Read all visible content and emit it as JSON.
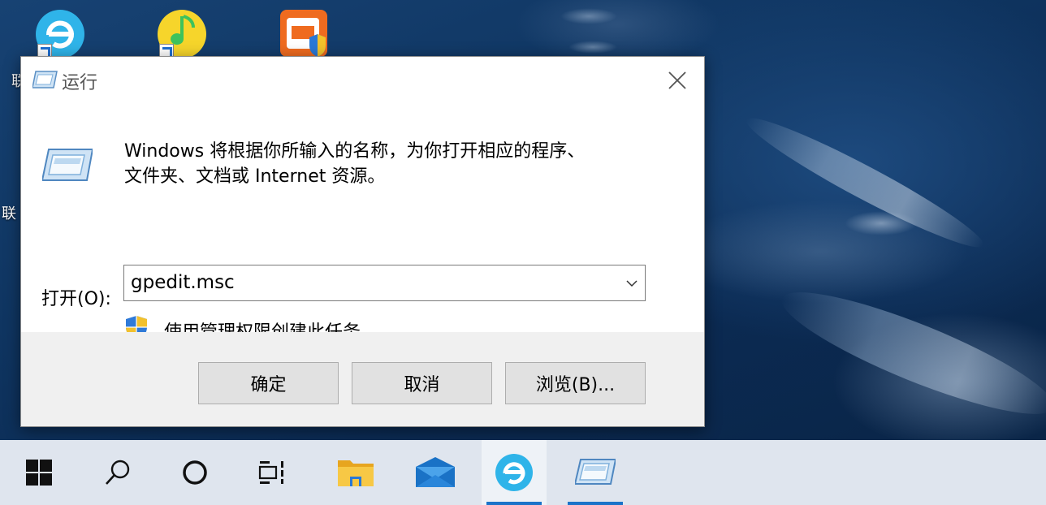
{
  "desktop": {
    "label_top_left": "联",
    "label_mid_left": "联"
  },
  "dialog": {
    "title": "运行",
    "description_line1": "Windows 将根据你所输入的名称，为你打开相应的程序、",
    "description_line2": "文件夹、文档或 Internet 资源。",
    "open_label": "打开(O):",
    "open_value": "gpedit.msc",
    "admin_note": "使用管理权限创建此任务。",
    "buttons": {
      "ok": "确定",
      "cancel": "取消",
      "browse": "浏览(B)..."
    }
  },
  "taskbar": {
    "items": [
      "start-icon",
      "search-icon",
      "cortana-icon",
      "task-view-icon",
      "file-explorer-icon",
      "mail-icon",
      "edge-browser-icon",
      "run-app-icon"
    ]
  },
  "colors": {
    "accent": "#1a73c9",
    "taskbar_bg": "#dfe5ee",
    "footer_bg": "#f0f0f0"
  }
}
